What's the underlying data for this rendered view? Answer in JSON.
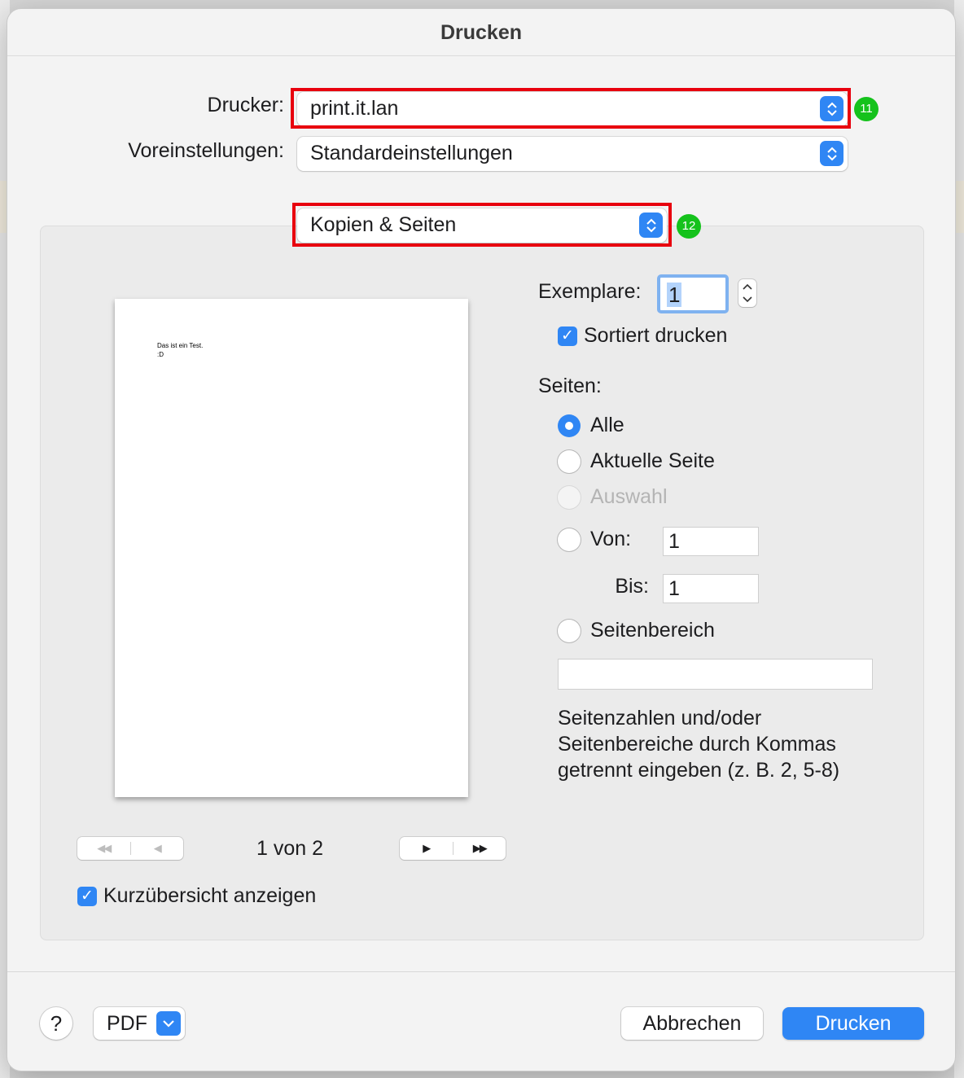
{
  "dialog": {
    "title": "Drucken"
  },
  "printer": {
    "label": "Drucker:",
    "value": "print.it.lan",
    "badge": "11"
  },
  "presets": {
    "label": "Voreinstellungen:",
    "value": "Standardeinstellungen"
  },
  "section": {
    "value": "Kopien & Seiten",
    "badge": "12"
  },
  "preview": {
    "lines": [
      "Das ist ein Test.",
      ":D"
    ],
    "page_indicator": "1 von 2",
    "show_thumbnails_label": "Kurzübersicht anzeigen",
    "show_thumbnails_checked": true
  },
  "copies": {
    "label": "Exemplare:",
    "value": "1",
    "collate_label": "Sortiert drucken",
    "collate_checked": true
  },
  "pages": {
    "label": "Seiten:",
    "options": [
      {
        "label": "Alle",
        "selected": true,
        "enabled": true
      },
      {
        "label": "Aktuelle Seite",
        "selected": false,
        "enabled": true
      },
      {
        "label": "Auswahl",
        "selected": false,
        "enabled": false
      },
      {
        "label": "Von:",
        "selected": false,
        "enabled": true
      },
      {
        "label": "Seitenbereich",
        "selected": false,
        "enabled": true
      }
    ],
    "from_value": "1",
    "to_label": "Bis:",
    "to_value": "1",
    "range_value": "",
    "help_text": [
      "Seitenzahlen und/oder",
      "Seitenbereiche durch Kommas",
      "getrennt eingeben (z. B. 2, 5-8)"
    ]
  },
  "footer": {
    "help_label": "?",
    "pdf_label": "PDF",
    "cancel_label": "Abbrechen",
    "print_label": "Drucken"
  },
  "colors": {
    "accent": "#2f86f4",
    "highlight_border": "#e8000e",
    "badge": "#15c21c"
  }
}
